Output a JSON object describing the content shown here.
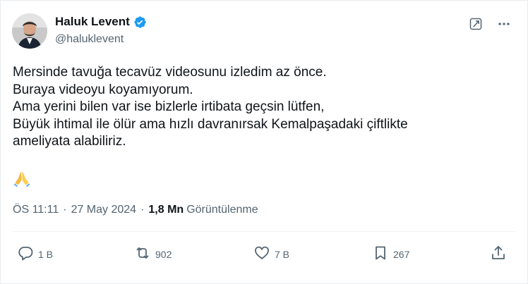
{
  "author": {
    "name": "Haluk Levent",
    "handle": "@haluklevent",
    "verified": true
  },
  "tweet": {
    "lines": [
      "Mersinde tavuğa tecavüz videosunu izledim az önce.",
      "Buraya videoyu koyamıyorum.",
      "Ama yerini bilen var ise bizlerle irtibata geçsin lütfen,",
      "Büyük ihtimal ile ölür ama hızlı davranırsak Kemalpaşadaki çiftlikte",
      "ameliyata alabiliriz."
    ],
    "emoji": "🙏"
  },
  "meta": {
    "time": "ÖS 11:11",
    "separator": "·",
    "date": "27 May 2024",
    "views_count": "1,8 Mn",
    "views_label": "Görüntülenme"
  },
  "actions": {
    "replies": "1 B",
    "retweets": "902",
    "likes": "7 B",
    "bookmarks": "267"
  },
  "colors": {
    "text": "#0f1419",
    "secondary": "#536471",
    "verified": "#1d9bf0"
  }
}
